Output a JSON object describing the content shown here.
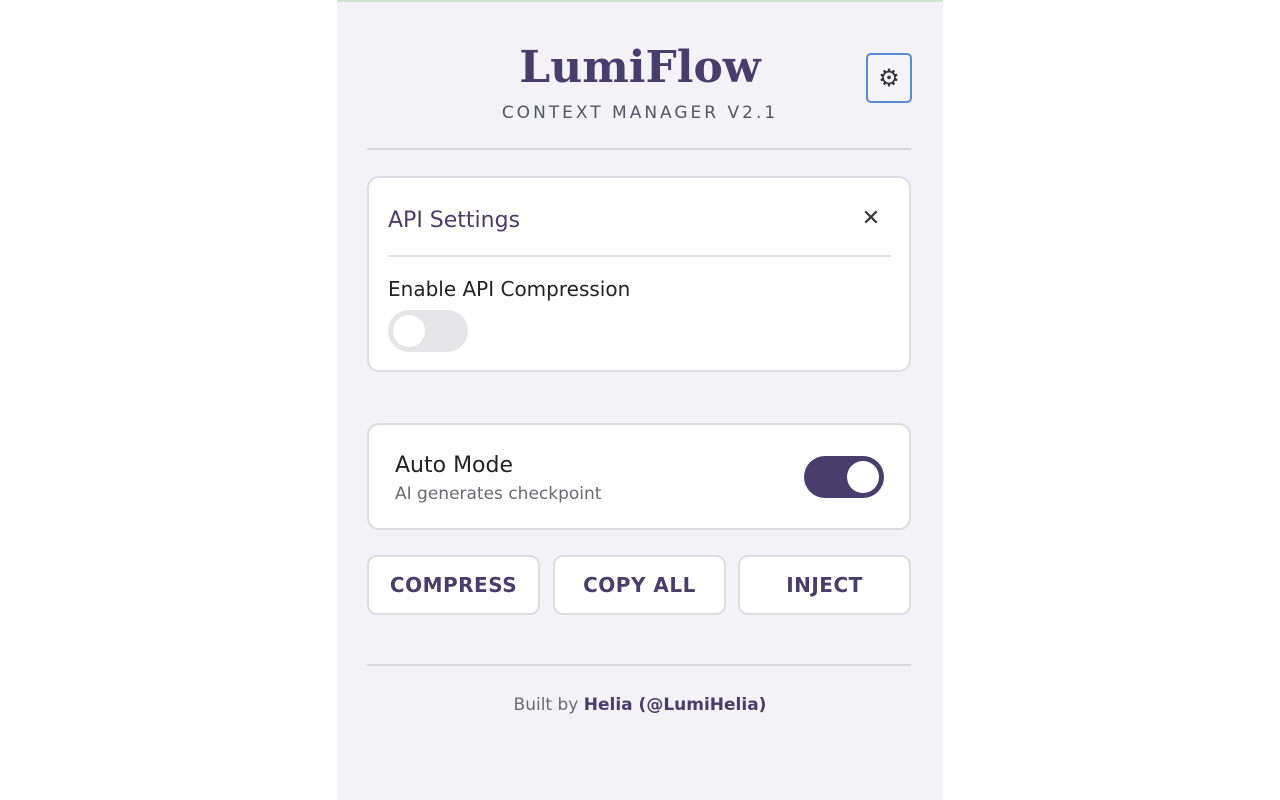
{
  "header": {
    "title": "LumiFlow",
    "subtitle": "CONTEXT MANAGER V2.1",
    "settings_icon": "gear-icon"
  },
  "api_settings": {
    "title": "API Settings",
    "close_glyph": "✕",
    "close_icon": "close-icon",
    "compression_label": "Enable API Compression",
    "compression_enabled": false
  },
  "auto_mode": {
    "title": "Auto Mode",
    "description": "AI generates checkpoint",
    "enabled": true
  },
  "actions": {
    "compress": "COMPRESS",
    "copy_all": "COPY ALL",
    "inject": "INJECT"
  },
  "footer": {
    "prefix": "Built by",
    "author": "Helia (@LumiHelia)"
  },
  "colors": {
    "accent": "#483d6b",
    "panel_bg": "#f2f2f7",
    "focus_ring": "#5b8ad6"
  }
}
